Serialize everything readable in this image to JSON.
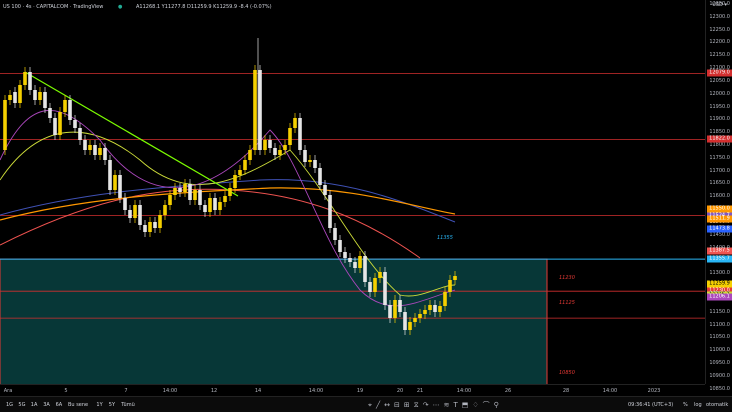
{
  "header": {
    "title": "US 100 · 4s · CAPITALCOM · TradingView",
    "ohlc": "A11268.1  Y11277.8  D11259.9  K11259.9  -8.4 (-0.07%)"
  },
  "currency": "USD ▾",
  "colors": {
    "bull": "#f5d000",
    "bear": "#e6e6e6",
    "zone": "#0a4a4a",
    "zoneBorder": "#e53935",
    "trendline": "#7cfc00",
    "levelRed": "#d32f2f",
    "levelCyan": "#29b6f6"
  },
  "price_axis": {
    "ticks": [
      "12350.0",
      "12300.0",
      "12250.0",
      "12200.0",
      "12150.0",
      "12100.0",
      "12050.0",
      "12000.0",
      "11950.0",
      "11900.0",
      "11850.0",
      "11800.0",
      "11750.0",
      "11700.0",
      "11650.0",
      "11600.0",
      "11550.0",
      "11500.0",
      "11450.0",
      "11400.0",
      "11350.0",
      "11300.0",
      "11250.0",
      "11200.0",
      "11150.0",
      "11100.0",
      "11050.0",
      "11000.0",
      "10950.0",
      "10900.0",
      "10850.0",
      "10800.0"
    ],
    "labels": [
      {
        "text": "12079.0",
        "color": "#d32f2f"
      },
      {
        "text": "11822.0",
        "color": "#d32f2f"
      },
      {
        "text": "11550.0",
        "color": "#ff9800"
      },
      {
        "text": "11525.0",
        "color": "#e53935"
      },
      {
        "text": "11524.7",
        "color": "#7e57c2"
      },
      {
        "text": "11511.9",
        "color": "#ff9800"
      },
      {
        "text": "11473.8",
        "color": "#2962ff"
      },
      {
        "text": "11387.5",
        "color": "#ef5350"
      },
      {
        "text": "11355.7",
        "color": "#29b6f6"
      },
      {
        "text": "11259.9",
        "color": "#f5d000"
      },
      {
        "text": "11230.0",
        "color": "#e53935"
      },
      {
        "text": "11216.1",
        "color": "#cddc39"
      },
      {
        "text": "11206.1",
        "color": "#ab47bc"
      }
    ]
  },
  "zone_labels": {
    "level_11355": "11355",
    "level_11230": "11230",
    "level_11125": "11125",
    "level_10850": "10850"
  },
  "x_axis": [
    "Ara",
    "5",
    "7",
    "14:00",
    "12",
    "14",
    "14:00",
    "19",
    "20",
    "21",
    "14:00",
    "26",
    "28",
    "14:00",
    "2023"
  ],
  "bottom": {
    "timeframes": [
      "1G",
      "5G",
      "1A",
      "3A",
      "6A",
      "Bu sene",
      "1Y",
      "5Y",
      "Tümü"
    ],
    "tools": [
      "⌖",
      "╱",
      "↔",
      "⊟",
      "⊞",
      "⧖",
      "↷",
      "⋯",
      "≋",
      "T",
      "⬒",
      "♢",
      "⌒",
      "⚲"
    ],
    "clock": "09:36:41 (UTC+3)",
    "pct": "%",
    "log": "log",
    "auto": "otomatik"
  }
}
